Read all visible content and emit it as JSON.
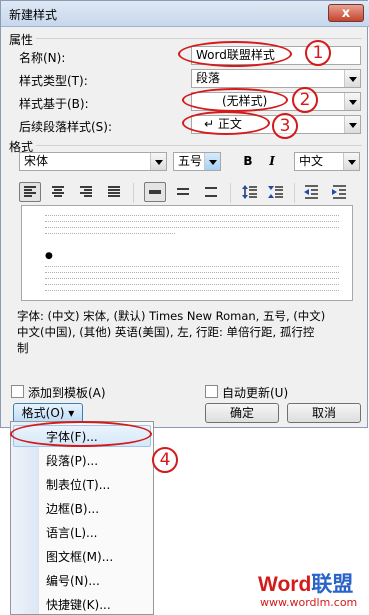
{
  "dialog": {
    "title": "新建样式",
    "close_label": "x",
    "properties_section": "属性",
    "name_label": "名称(N):",
    "name_value": "Word联盟样式",
    "style_type_label": "样式类型(T):",
    "style_type_value": "段落",
    "based_on_label": "样式基于(B):",
    "based_on_value": "(无样式)",
    "next_style_label": "后续段落样式(S):",
    "next_style_value": "↵ 正文",
    "format_section": "格式",
    "font_value": "宋体",
    "size_value": "五号",
    "bold_label": "B",
    "italic_label": "I",
    "underline_label": "U",
    "lang_value": "中文",
    "description_line1": "字体: (中文) 宋体, (默认) Times New Roman, 五号, (中文)",
    "description_line2": "中文(中国), (其他) 英语(美国), 左, 行距: 单倍行距, 孤行控",
    "description_line3": "制",
    "add_to_template_label": "添加到模板(A)",
    "auto_update_label": "自动更新(U)",
    "format_button_label": "格式(O) ▾",
    "ok_label": "确定",
    "cancel_label": "取消"
  },
  "menu": {
    "items": [
      {
        "label": "字体(F)..."
      },
      {
        "label": "段落(P)..."
      },
      {
        "label": "制表位(T)..."
      },
      {
        "label": "边框(B)..."
      },
      {
        "label": "语言(L)..."
      },
      {
        "label": "图文框(M)..."
      },
      {
        "label": "编号(N)..."
      },
      {
        "label": "快捷键(K)..."
      }
    ]
  },
  "annotations": {
    "n1": "1",
    "n2": "2",
    "n3": "3",
    "n4": "4"
  },
  "watermark": {
    "brand_word": "Word",
    "brand_cn": "联盟",
    "url": "www.wordlm.com"
  },
  "colors": {
    "annotation_red": "#d41a1a",
    "title_gradient": "#c7d7ec",
    "menu_highlight": "#d5e8f9"
  }
}
